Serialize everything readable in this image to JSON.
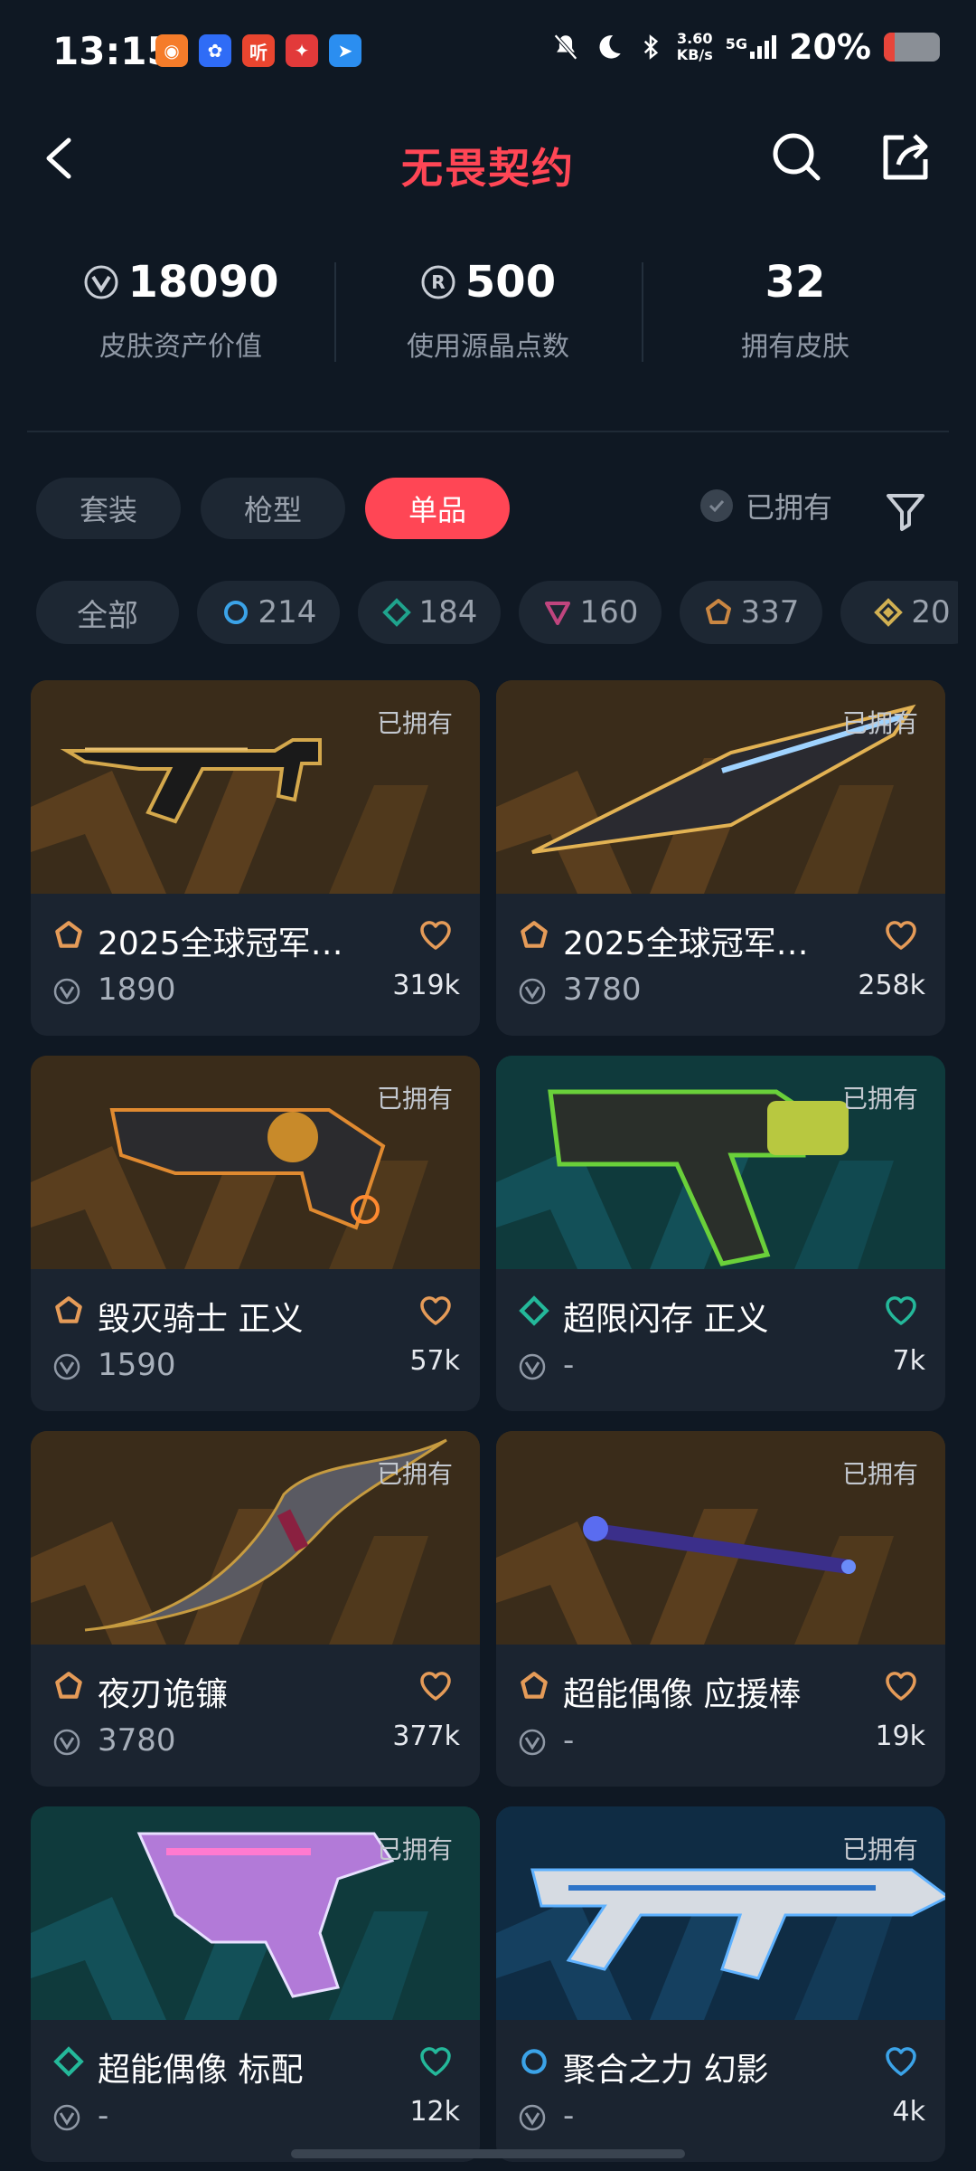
{
  "status": {
    "time": "13:15",
    "apps": [
      {
        "name": "qq-icon",
        "color": "#f57c2a",
        "glyph": "◉"
      },
      {
        "name": "baidu-icon",
        "color": "#2f6cf6",
        "glyph": "✿"
      },
      {
        "name": "ting-icon",
        "color": "#e9452f",
        "glyph": "听"
      },
      {
        "name": "game-icon",
        "color": "#e23a3a",
        "glyph": "✦"
      },
      {
        "name": "send-icon",
        "color": "#2b8ef0",
        "glyph": "➤"
      }
    ],
    "net_speed_value": "3.60",
    "net_speed_unit": "KB/s",
    "network": "5G",
    "battery_text": "20%",
    "battery_level": 0.2,
    "battery_color": "#e8453a"
  },
  "header": {
    "title": "无畏契约",
    "accent": "#ff4655"
  },
  "stats": [
    {
      "value": "18090",
      "label": "皮肤资产价值",
      "icon": "vp-icon"
    },
    {
      "value": "500",
      "label": "使用源晶点数",
      "icon": "radianite-icon"
    },
    {
      "value": "32",
      "label": "拥有皮肤",
      "icon": ""
    }
  ],
  "tabs": [
    {
      "label": "套装",
      "active": false
    },
    {
      "label": "枪型",
      "active": false
    },
    {
      "label": "单品",
      "active": true
    }
  ],
  "owned_filter_label": "已拥有",
  "tiers": [
    {
      "label": "全部",
      "icon": ""
    },
    {
      "label": "214",
      "icon": "select-tier-icon",
      "color": "#3ba3e8"
    },
    {
      "label": "184",
      "icon": "deluxe-tier-icon",
      "color": "#1fa38d"
    },
    {
      "label": "160",
      "icon": "premium-tier-icon",
      "color": "#c0457e"
    },
    {
      "label": "337",
      "icon": "exclusive-tier-icon",
      "color": "#c98642"
    },
    {
      "label": "20",
      "icon": "ultra-tier-icon",
      "color": "#d1b052"
    }
  ],
  "cards": [
    {
      "owned": "已拥有",
      "name": "2025全球冠军…",
      "price": "1890",
      "likes": "319k",
      "tier_color": "#e59b58",
      "heart_color": "#e59b58",
      "bg": "orange"
    },
    {
      "owned": "已拥有",
      "name": "2025全球冠军…",
      "price": "3780",
      "likes": "258k",
      "tier_color": "#e59b58",
      "heart_color": "#e59b58",
      "bg": "orange"
    },
    {
      "owned": "已拥有",
      "name": "毁灭骑士 正义",
      "price": "1590",
      "likes": "57k",
      "tier_color": "#e59b58",
      "heart_color": "#e59b58",
      "bg": "orange"
    },
    {
      "owned": "已拥有",
      "name": "超限闪存 正义",
      "price": "-",
      "likes": "7k",
      "tier_color": "#24b89a",
      "heart_color": "#24b89a",
      "bg": "teal"
    },
    {
      "owned": "已拥有",
      "name": "夜刃诡镰",
      "price": "3780",
      "likes": "377k",
      "tier_color": "#e59b58",
      "heart_color": "#e59b58",
      "bg": "orange"
    },
    {
      "owned": "已拥有",
      "name": "超能偶像 应援棒",
      "price": "-",
      "likes": "19k",
      "tier_color": "#e59b58",
      "heart_color": "#e59b58",
      "bg": "orange"
    },
    {
      "owned": "已拥有",
      "name": "超能偶像 标配",
      "price": "-",
      "likes": "12k",
      "tier_color": "#24b89a",
      "heart_color": "#24b89a",
      "bg": "teal"
    },
    {
      "owned": "已拥有",
      "name": "聚合之力 幻影",
      "price": "-",
      "likes": "4k",
      "tier_color": "#3ba3e8",
      "heart_color": "#3ba3e8",
      "bg": "blue"
    }
  ]
}
